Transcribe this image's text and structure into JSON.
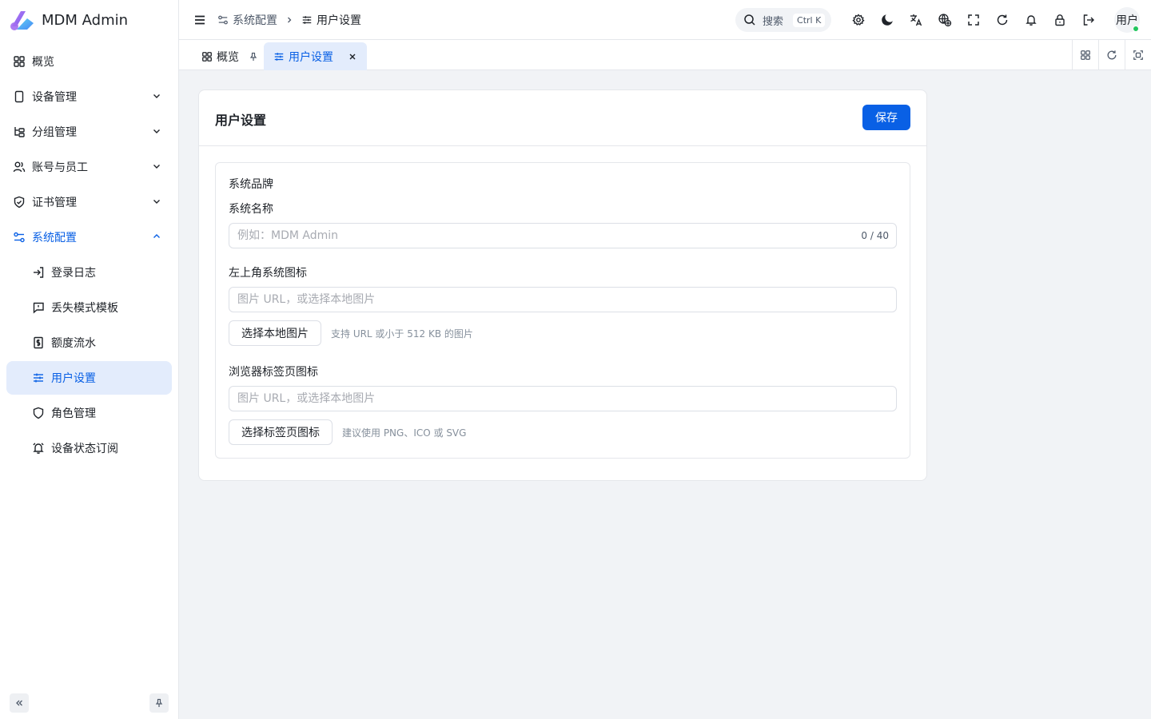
{
  "brand": {
    "title": "MDM Admin"
  },
  "sidebar": {
    "items": [
      {
        "label": "概览",
        "icon": "dashboard-icon"
      },
      {
        "label": "设备管理",
        "icon": "device-icon"
      },
      {
        "label": "分组管理",
        "icon": "tree-icon"
      },
      {
        "label": "账号与员工",
        "icon": "users-icon"
      },
      {
        "label": "证书管理",
        "icon": "shield-check-icon"
      },
      {
        "label": "系统配置",
        "icon": "settings-sliders-icon"
      }
    ],
    "sub_items": [
      {
        "label": "登录日志",
        "icon": "login-icon"
      },
      {
        "label": "丢失模式模板",
        "icon": "alert-message-icon"
      },
      {
        "label": "额度流水",
        "icon": "receipt-icon"
      },
      {
        "label": "用户设置",
        "icon": "sliders-icon"
      },
      {
        "label": "角色管理",
        "icon": "shield-icon"
      },
      {
        "label": "设备状态订阅",
        "icon": "bell-ring-icon"
      }
    ]
  },
  "header": {
    "breadcrumb": [
      "系统配置",
      "用户设置"
    ],
    "search_label": "搜索",
    "search_shortcut": "Ctrl K",
    "user_label": "用户",
    "icons": [
      "settings-icon",
      "moon-icon",
      "translate-icon",
      "globe-icon",
      "fullscreen-icon",
      "refresh-icon",
      "bell-icon",
      "lock-icon",
      "logout-icon"
    ]
  },
  "tabs": [
    {
      "label": "概览",
      "active": false
    },
    {
      "label": "用户设置",
      "active": true
    }
  ],
  "page": {
    "title": "用户设置",
    "save_label": "保存",
    "section_title": "系统品牌",
    "name_label": "系统名称",
    "name_placeholder": "例如：MDM Admin",
    "name_counter": "0 / 40",
    "logo_label": "左上角系统图标",
    "logo_placeholder": "图片 URL，或选择本地图片",
    "logo_button": "选择本地图片",
    "logo_hint": "支持 URL 或小于 512 KB 的图片",
    "favicon_label": "浏览器标签页图标",
    "favicon_placeholder": "图片 URL，或选择本地图片",
    "favicon_button": "选择标签页图标",
    "favicon_hint": "建议使用 PNG、ICO 或 SVG"
  },
  "colors": {
    "accent": "#0960e5",
    "selected_bg": "#e3ecfc",
    "online": "#22c55e"
  }
}
